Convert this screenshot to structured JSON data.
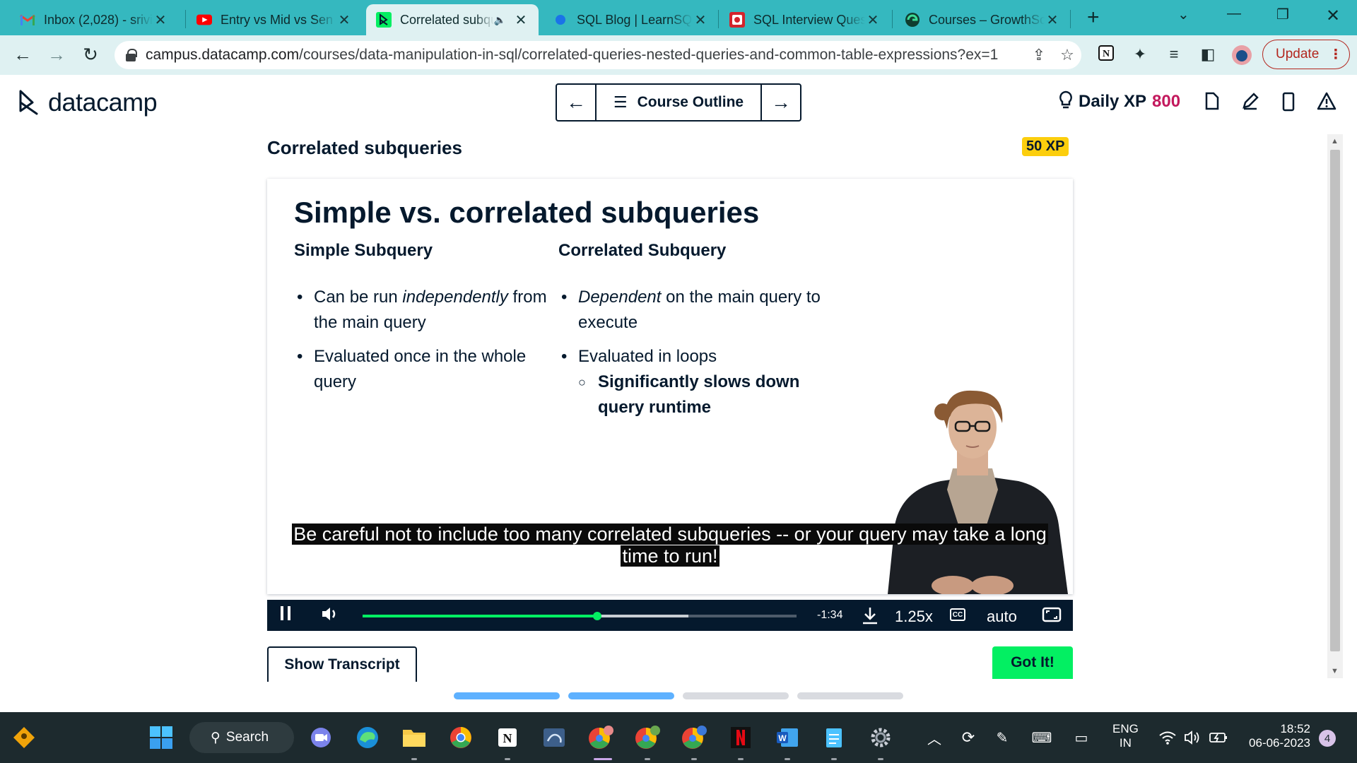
{
  "browser": {
    "tabs": [
      {
        "label": "Inbox (2,028) - srivi",
        "icon": "gmail-icon"
      },
      {
        "label": "Entry vs Mid vs Sen",
        "icon": "youtube-icon"
      },
      {
        "label": "Correlated subqueries",
        "icon": "datacamp-icon",
        "active": true,
        "audio": true
      },
      {
        "label": "SQL Blog | LearnSQL",
        "icon": "learnsql-icon"
      },
      {
        "label": "SQL Interview Questions",
        "icon": "stratascratch-icon"
      },
      {
        "label": "Courses – GrowthSchool",
        "icon": "growthschool-icon"
      }
    ],
    "url_host": "campus.datacamp.com",
    "url_path": "/courses/data-manipulation-in-sql/correlated-queries-nested-queries-and-common-table-expressions?ex=1",
    "update_label": "Update"
  },
  "header": {
    "logo_text": "datacamp",
    "course_outline_label": "Course Outline",
    "daily_xp_label": "Daily XP",
    "daily_xp_value": "800"
  },
  "exercise": {
    "title": "Correlated subqueries",
    "xp_badge": "50 XP"
  },
  "slide": {
    "title": "Simple vs. correlated subqueries",
    "left_heading": "Simple Subquery",
    "left_b1_pre": "Can be run ",
    "left_b1_em": "independently",
    "left_b1_post": " from the main query",
    "left_b2": "Evaluated once in the whole query",
    "right_heading": "Correlated Subquery",
    "right_b1_em": "Dependent",
    "right_b1_post": " on the main query to execute",
    "right_b2": "Evaluated in loops",
    "right_b2_sub": "Significantly slows down query runtime"
  },
  "video": {
    "caption": "Be careful not to include too many correlated subqueries -- or your query may take a long time to run!",
    "time_remaining": "-1:34",
    "speed": "1.25x",
    "quality": "auto",
    "progress_fraction": 0.54,
    "buffered_fraction": 0.75
  },
  "actions": {
    "show_transcript": "Show Transcript",
    "got_it": "Got It!"
  },
  "pager": {
    "total": 4,
    "completed": 2
  },
  "taskbar": {
    "search_label": "Search",
    "lang_line1": "ENG",
    "lang_line2": "IN",
    "time": "18:52",
    "date": "06-06-2023",
    "notifications": "4"
  },
  "colors": {
    "brand_green": "#03ef62",
    "brand_navy": "#05192d",
    "xp_pink": "#c3195d",
    "xp_badge_yellow": "#fcce0d",
    "chrome_teal": "#35b8bf"
  }
}
